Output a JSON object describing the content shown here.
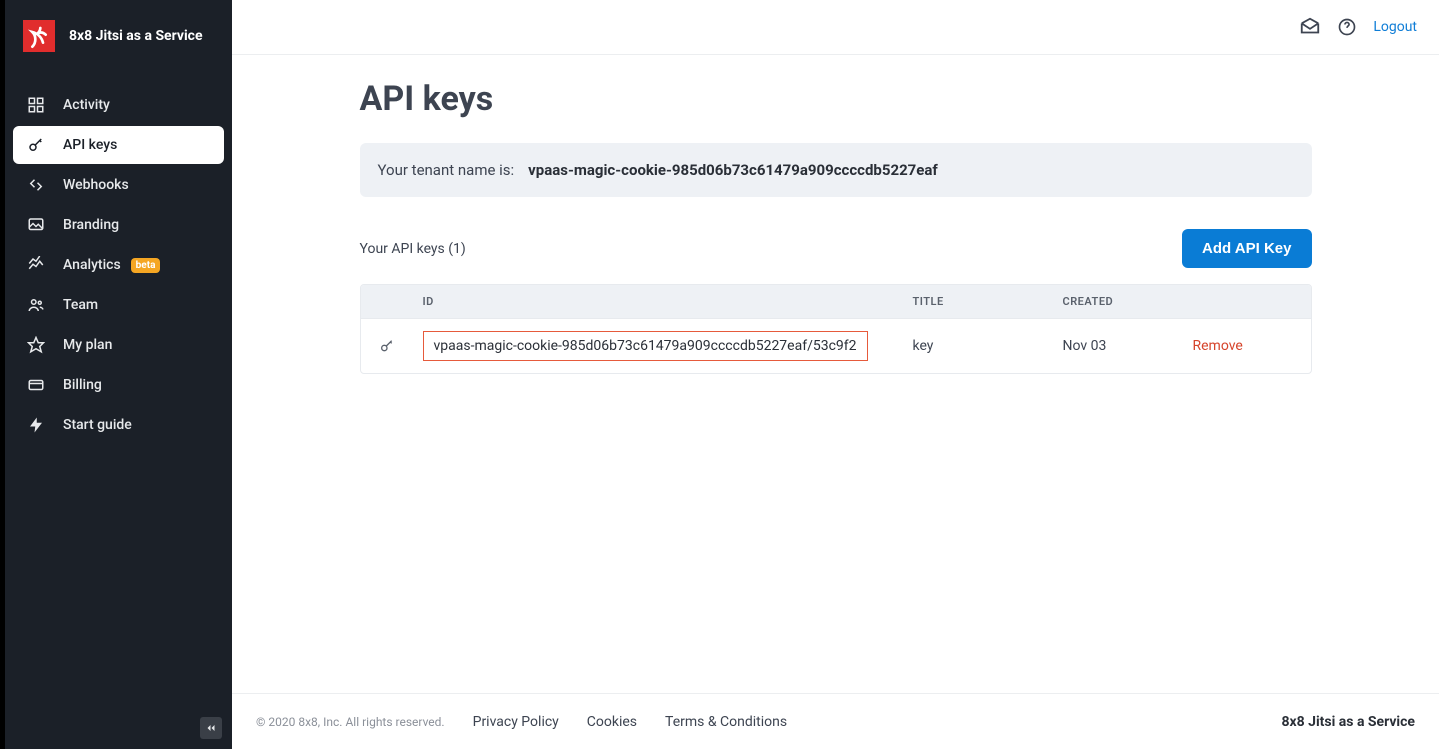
{
  "brand": {
    "title": "8x8 Jitsi as a Service"
  },
  "sidebar": {
    "items": [
      {
        "label": "Activity"
      },
      {
        "label": "API keys"
      },
      {
        "label": "Webhooks"
      },
      {
        "label": "Branding"
      },
      {
        "label": "Analytics",
        "badge": "beta"
      },
      {
        "label": "Team"
      },
      {
        "label": "My plan"
      },
      {
        "label": "Billing"
      },
      {
        "label": "Start guide"
      }
    ]
  },
  "topbar": {
    "logout_label": "Logout"
  },
  "page": {
    "title": "API keys",
    "tenant_label": "Your tenant name is:",
    "tenant_value": "vpaas-magic-cookie-985d06b73c61479a909ccccdb5227eaf",
    "keys_count_text": "Your API keys (1)",
    "add_button": "Add API Key"
  },
  "table": {
    "headers": {
      "id": "ID",
      "title": "TITLE",
      "created": "CREATED"
    },
    "rows": [
      {
        "id": "vpaas-magic-cookie-985d06b73c61479a909ccccdb5227eaf/53c9f2",
        "title": "key",
        "created": "Nov 03",
        "remove_label": "Remove"
      }
    ]
  },
  "footer": {
    "copyright": "© 2020 8x8, Inc. All rights reserved.",
    "privacy": "Privacy Policy",
    "cookies": "Cookies",
    "terms": "Terms & Conditions",
    "brand": "8x8 Jitsi as a Service"
  }
}
